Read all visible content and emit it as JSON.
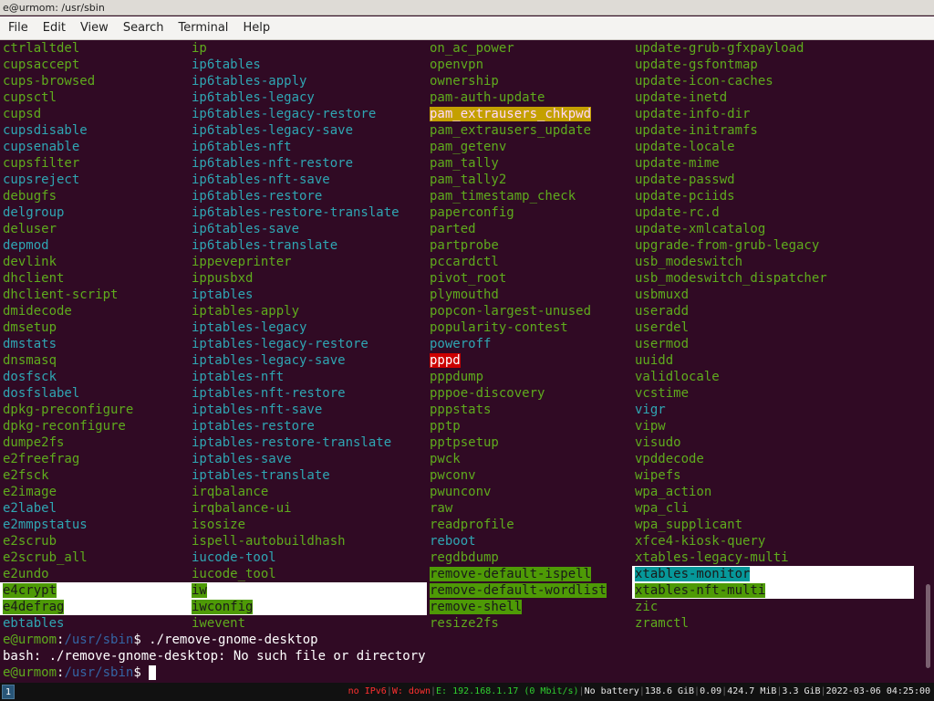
{
  "window": {
    "title": "e@urmom: /usr/sbin"
  },
  "menu": [
    "File",
    "Edit",
    "View",
    "Search",
    "Terminal",
    "Help"
  ],
  "listing": {
    "columns": [
      [
        {
          "t": "ctrlaltdel",
          "c": "exe"
        },
        {
          "t": "cupsaccept",
          "c": "exe"
        },
        {
          "t": "cups-browsed",
          "c": "exe"
        },
        {
          "t": "cupsctl",
          "c": "exe"
        },
        {
          "t": "cupsd",
          "c": "exe"
        },
        {
          "t": "cupsdisable",
          "c": "link"
        },
        {
          "t": "cupsenable",
          "c": "link"
        },
        {
          "t": "cupsfilter",
          "c": "exe"
        },
        {
          "t": "cupsreject",
          "c": "link"
        },
        {
          "t": "debugfs",
          "c": "exe"
        },
        {
          "t": "delgroup",
          "c": "link"
        },
        {
          "t": "deluser",
          "c": "exe"
        },
        {
          "t": "depmod",
          "c": "link"
        },
        {
          "t": "devlink",
          "c": "exe"
        },
        {
          "t": "dhclient",
          "c": "exe"
        },
        {
          "t": "dhclient-script",
          "c": "exe"
        },
        {
          "t": "dmidecode",
          "c": "exe"
        },
        {
          "t": "dmsetup",
          "c": "exe"
        },
        {
          "t": "dmstats",
          "c": "link"
        },
        {
          "t": "dnsmasq",
          "c": "exe"
        },
        {
          "t": "dosfsck",
          "c": "link"
        },
        {
          "t": "dosfslabel",
          "c": "link"
        },
        {
          "t": "dpkg-preconfigure",
          "c": "exe"
        },
        {
          "t": "dpkg-reconfigure",
          "c": "exe"
        },
        {
          "t": "dumpe2fs",
          "c": "exe"
        },
        {
          "t": "e2freefrag",
          "c": "exe"
        },
        {
          "t": "e2fsck",
          "c": "exe"
        },
        {
          "t": "e2image",
          "c": "exe"
        },
        {
          "t": "e2label",
          "c": "link"
        },
        {
          "t": "e2mmpstatus",
          "c": "link"
        },
        {
          "t": "e2scrub",
          "c": "exe"
        },
        {
          "t": "e2scrub_all",
          "c": "exe"
        },
        {
          "t": "e2undo",
          "c": "exe"
        },
        {
          "t": "e4crypt",
          "c": "hl-green",
          "row": "white"
        },
        {
          "t": "e4defrag",
          "c": "hl-green",
          "row": "white"
        },
        {
          "t": "ebtables",
          "c": "link"
        }
      ],
      [
        {
          "t": "ip",
          "c": "exe"
        },
        {
          "t": "ip6tables",
          "c": "link"
        },
        {
          "t": "ip6tables-apply",
          "c": "link"
        },
        {
          "t": "ip6tables-legacy",
          "c": "link"
        },
        {
          "t": "ip6tables-legacy-restore",
          "c": "link"
        },
        {
          "t": "ip6tables-legacy-save",
          "c": "link"
        },
        {
          "t": "ip6tables-nft",
          "c": "link"
        },
        {
          "t": "ip6tables-nft-restore",
          "c": "link"
        },
        {
          "t": "ip6tables-nft-save",
          "c": "link"
        },
        {
          "t": "ip6tables-restore",
          "c": "link"
        },
        {
          "t": "ip6tables-restore-translate",
          "c": "link"
        },
        {
          "t": "ip6tables-save",
          "c": "link"
        },
        {
          "t": "ip6tables-translate",
          "c": "link"
        },
        {
          "t": "ippeveprinter",
          "c": "exe"
        },
        {
          "t": "ippusbxd",
          "c": "exe"
        },
        {
          "t": "iptables",
          "c": "link"
        },
        {
          "t": "iptables-apply",
          "c": "exe"
        },
        {
          "t": "iptables-legacy",
          "c": "link"
        },
        {
          "t": "iptables-legacy-restore",
          "c": "link"
        },
        {
          "t": "iptables-legacy-save",
          "c": "link"
        },
        {
          "t": "iptables-nft",
          "c": "link"
        },
        {
          "t": "iptables-nft-restore",
          "c": "link"
        },
        {
          "t": "iptables-nft-save",
          "c": "link"
        },
        {
          "t": "iptables-restore",
          "c": "link"
        },
        {
          "t": "iptables-restore-translate",
          "c": "link"
        },
        {
          "t": "iptables-save",
          "c": "link"
        },
        {
          "t": "iptables-translate",
          "c": "link"
        },
        {
          "t": "irqbalance",
          "c": "exe"
        },
        {
          "t": "irqbalance-ui",
          "c": "exe"
        },
        {
          "t": "isosize",
          "c": "exe"
        },
        {
          "t": "ispell-autobuildhash",
          "c": "exe"
        },
        {
          "t": "iucode-tool",
          "c": "link"
        },
        {
          "t": "iucode_tool",
          "c": "exe"
        },
        {
          "t": "iw",
          "c": "hl-green",
          "row": "white"
        },
        {
          "t": "iwconfig",
          "c": "hl-green",
          "row": "white"
        },
        {
          "t": "iwevent",
          "c": "exe"
        }
      ],
      [
        {
          "t": "on_ac_power",
          "c": "exe"
        },
        {
          "t": "openvpn",
          "c": "exe"
        },
        {
          "t": "ownership",
          "c": "exe"
        },
        {
          "t": "pam-auth-update",
          "c": "exe"
        },
        {
          "t": "pam_extrausers_chkpwd",
          "c": "hl-yellow"
        },
        {
          "t": "pam_extrausers_update",
          "c": "exe"
        },
        {
          "t": "pam_getenv",
          "c": "exe"
        },
        {
          "t": "pam_tally",
          "c": "exe"
        },
        {
          "t": "pam_tally2",
          "c": "exe"
        },
        {
          "t": "pam_timestamp_check",
          "c": "exe"
        },
        {
          "t": "paperconfig",
          "c": "exe"
        },
        {
          "t": "parted",
          "c": "exe"
        },
        {
          "t": "partprobe",
          "c": "exe"
        },
        {
          "t": "pccardctl",
          "c": "exe"
        },
        {
          "t": "pivot_root",
          "c": "exe"
        },
        {
          "t": "plymouthd",
          "c": "exe"
        },
        {
          "t": "popcon-largest-unused",
          "c": "exe"
        },
        {
          "t": "popularity-contest",
          "c": "exe"
        },
        {
          "t": "poweroff",
          "c": "link"
        },
        {
          "t": "pppd",
          "c": "hl-red"
        },
        {
          "t": "pppdump",
          "c": "exe"
        },
        {
          "t": "pppoe-discovery",
          "c": "exe"
        },
        {
          "t": "pppstats",
          "c": "exe"
        },
        {
          "t": "pptp",
          "c": "exe"
        },
        {
          "t": "pptpsetup",
          "c": "exe"
        },
        {
          "t": "pwck",
          "c": "exe"
        },
        {
          "t": "pwconv",
          "c": "exe"
        },
        {
          "t": "pwunconv",
          "c": "exe"
        },
        {
          "t": "raw",
          "c": "exe"
        },
        {
          "t": "readprofile",
          "c": "exe"
        },
        {
          "t": "reboot",
          "c": "link"
        },
        {
          "t": "regdbdump",
          "c": "exe"
        },
        {
          "t": "remove-default-ispell",
          "c": "hl-green"
        },
        {
          "t": "remove-default-wordlist",
          "c": "hl-green"
        },
        {
          "t": "remove-shell",
          "c": "hl-green"
        },
        {
          "t": "resize2fs",
          "c": "exe"
        }
      ],
      [
        {
          "t": "update-grub-gfxpayload",
          "c": "exe"
        },
        {
          "t": "update-gsfontmap",
          "c": "exe"
        },
        {
          "t": "update-icon-caches",
          "c": "exe"
        },
        {
          "t": "update-inetd",
          "c": "exe"
        },
        {
          "t": "update-info-dir",
          "c": "exe"
        },
        {
          "t": "update-initramfs",
          "c": "exe"
        },
        {
          "t": "update-locale",
          "c": "exe"
        },
        {
          "t": "update-mime",
          "c": "exe"
        },
        {
          "t": "update-passwd",
          "c": "exe"
        },
        {
          "t": "update-pciids",
          "c": "exe"
        },
        {
          "t": "update-rc.d",
          "c": "exe"
        },
        {
          "t": "update-xmlcatalog",
          "c": "exe"
        },
        {
          "t": "upgrade-from-grub-legacy",
          "c": "exe"
        },
        {
          "t": "usb_modeswitch",
          "c": "exe"
        },
        {
          "t": "usb_modeswitch_dispatcher",
          "c": "exe"
        },
        {
          "t": "usbmuxd",
          "c": "exe"
        },
        {
          "t": "useradd",
          "c": "exe"
        },
        {
          "t": "userdel",
          "c": "exe"
        },
        {
          "t": "usermod",
          "c": "exe"
        },
        {
          "t": "uuidd",
          "c": "exe"
        },
        {
          "t": "validlocale",
          "c": "exe"
        },
        {
          "t": "vcstime",
          "c": "exe"
        },
        {
          "t": "vigr",
          "c": "link"
        },
        {
          "t": "vipw",
          "c": "exe"
        },
        {
          "t": "visudo",
          "c": "exe"
        },
        {
          "t": "vpddecode",
          "c": "exe"
        },
        {
          "t": "wipefs",
          "c": "exe"
        },
        {
          "t": "wpa_action",
          "c": "exe"
        },
        {
          "t": "wpa_cli",
          "c": "exe"
        },
        {
          "t": "wpa_supplicant",
          "c": "exe"
        },
        {
          "t": "xfce4-kiosk-query",
          "c": "exe"
        },
        {
          "t": "xtables-legacy-multi",
          "c": "exe"
        },
        {
          "t": "xtables-monitor",
          "c": "hl-cyan",
          "row": "white"
        },
        {
          "t": "xtables-nft-multi",
          "c": "hl-green",
          "row": "white"
        },
        {
          "t": "zic",
          "c": "exe"
        },
        {
          "t": "zramctl",
          "c": "exe"
        }
      ]
    ]
  },
  "session": {
    "prompt_user": "e@urmom",
    "prompt_path": "/usr/sbin",
    "prompt_symbol": "$",
    "command": " ./remove-gnome-desktop",
    "error": "bash: ./remove-gnome-desktop: No such file or directory"
  },
  "statusbar": {
    "workspace": "1",
    "ipv6": "no IPv6",
    "wifi": "W: down",
    "ethernet": "E: 192.168.1.17 (0 Mbit/s)",
    "battery": "No battery",
    "disk": "138.6 GiB",
    "load": "0.09",
    "mem_used": "424.7 MiB",
    "mem_avail": "3.3 GiB",
    "datetime": "2022-03-06 04:25:00"
  },
  "colors": {
    "background": "#300a24",
    "exe": "#5fab1d",
    "link": "#2fa6b3"
  }
}
